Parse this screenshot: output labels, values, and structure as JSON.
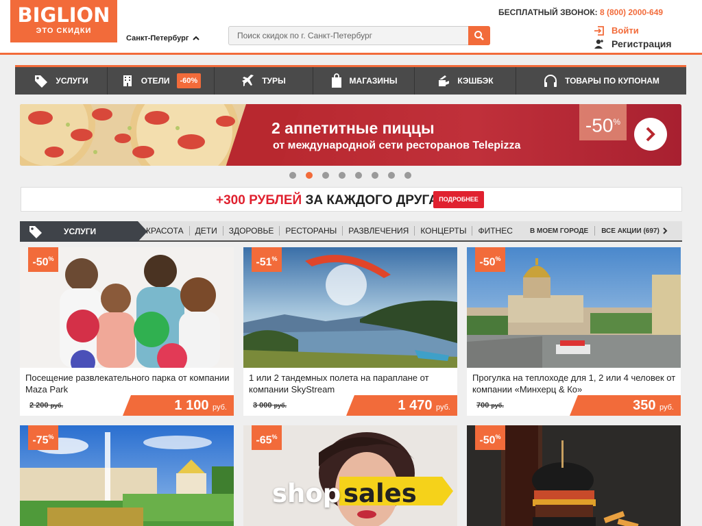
{
  "header": {
    "logo_brand": "BIGLION",
    "logo_tagline": "ЭТО СКИДКИ",
    "city": "Санкт-Петербург",
    "search_placeholder": "Поиск скидок по г. Санкт-Петербург",
    "phone_label": "БЕСПЛАТНЫЙ ЗВОНОК:",
    "phone_number": "8 (800) 2000-649",
    "login": "Войти",
    "register": "Регистрация",
    "accent_color": "#f26b3a"
  },
  "nav": {
    "items": [
      {
        "label": "УСЛУГИ",
        "icon": "tag-icon"
      },
      {
        "label": "ОТЕЛИ",
        "icon": "hotel-icon",
        "badge": "-60%"
      },
      {
        "label": "ТУРЫ",
        "icon": "plane-icon"
      },
      {
        "label": "МАГАЗИНЫ",
        "icon": "shopping-bag-icon"
      },
      {
        "label": "КЭШБЭК",
        "icon": "cashback-icon"
      },
      {
        "label": "ТОВАРЫ ПО КУПОНАМ",
        "icon": "headphones-icon"
      }
    ]
  },
  "banner": {
    "title": "2 аппетитные пиццы",
    "subtitle": "от международной сети ресторанов Telepizza",
    "discount": "-50",
    "discount_unit": "%",
    "slide_count": 8,
    "active_slide": 2
  },
  "promo": {
    "text_highlight": "+300 РУБЛЕЙ",
    "text_rest": " ЗА КАЖДОГО ДРУГА!",
    "button": "ПОДРОБНЕЕ"
  },
  "categories": {
    "active": "УСЛУГИ",
    "tabs": [
      "КРАСОТА",
      "ДЕТИ",
      "ЗДОРОВЬЕ",
      "РЕСТОРАНЫ",
      "РАЗВЛЕЧЕНИЯ",
      "КОНЦЕРТЫ",
      "ФИТНЕС"
    ],
    "in_my_city": "В МОЕМ ГОРОДЕ",
    "all_deals": "ВСЕ АКЦИИ (697)"
  },
  "cards": [
    {
      "discount": "-50",
      "title": "Посещение развлекательного парка от компании Maza Park",
      "old_price": "2 200",
      "new_price": "1 100",
      "unit": "руб."
    },
    {
      "discount": "-51",
      "title": "1 или 2 тандемных полета на параплане от компании SkyStream",
      "old_price": "3 000",
      "new_price": "1 470",
      "unit": "руб."
    },
    {
      "discount": "-50",
      "title": "Прогулка на теплоходе для 1, 2 или 4 человек от компании «Минхерц & Ко»",
      "old_price": "700",
      "new_price": "350",
      "unit": "руб."
    },
    {
      "discount": "-75"
    },
    {
      "discount": "-65",
      "image_text_a": "shop",
      "image_text_b": "sales"
    },
    {
      "discount": "-50"
    }
  ],
  "percent": "%"
}
